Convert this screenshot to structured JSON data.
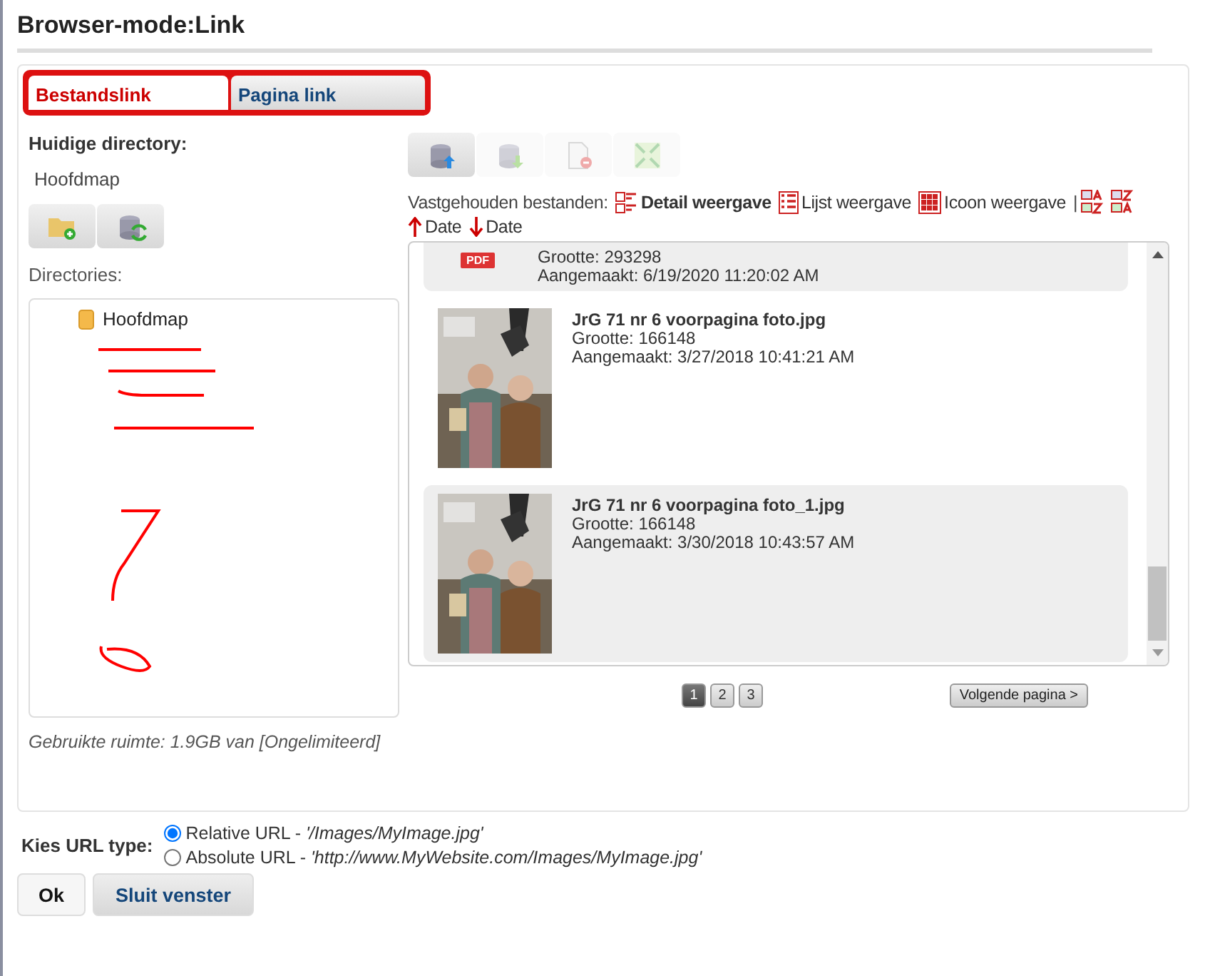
{
  "window": {
    "title": "Browser-mode:Link"
  },
  "tabs": [
    {
      "label": "Bestandslink",
      "selected": true
    },
    {
      "label": "Pagina link",
      "selected": false
    }
  ],
  "current_directory": {
    "label": "Huidige directory:",
    "value": "Hoofdmap"
  },
  "directory_toolbar": [
    {
      "kind": "new-folder",
      "disabled": false
    },
    {
      "kind": "refresh",
      "disabled": false
    }
  ],
  "file_toolbar": [
    {
      "kind": "upload",
      "disabled": false
    },
    {
      "kind": "download",
      "disabled": true
    },
    {
      "kind": "delete",
      "disabled": true
    },
    {
      "kind": "resize",
      "disabled": true
    }
  ],
  "directories": {
    "label": "Directories:",
    "tree": [
      {
        "name": "Hoofdmap"
      }
    ]
  },
  "usage": "Gebruikte ruimte: 1.9GB van [Ongelimiteerd]",
  "files_label": "Vastgehouden bestanden:",
  "views": [
    {
      "kind": "detail",
      "label": "Detail weergave",
      "selected": true
    },
    {
      "kind": "list",
      "label": "Lijst weergave",
      "selected": false
    },
    {
      "kind": "icon",
      "label": "Icoon weergave",
      "selected": false
    }
  ],
  "separator": "|",
  "sorts": [
    {
      "kind": "name-asc"
    },
    {
      "kind": "name-desc"
    },
    {
      "kind": "date-up",
      "label": "Date"
    },
    {
      "kind": "date-down",
      "label": "Date"
    }
  ],
  "files": [
    {
      "kind": "pdf",
      "badge": "PDF",
      "size": "Grootte: 293298",
      "created": "Aangemaakt: 6/19/2020 11:20:02 AM",
      "selected": true
    },
    {
      "kind": "picture",
      "name": "JrG 71 nr 6 voorpagina foto.jpg",
      "size": "Grootte: 166148",
      "created": "Aangemaakt: 3/27/2018 10:41:21 AM",
      "selected": false
    },
    {
      "kind": "picture",
      "name": "JrG 71 nr 6 voorpagina foto_1.jpg",
      "size": "Grootte: 166148",
      "created": "Aangemaakt: 3/30/2018 10:43:57 AM",
      "selected": true
    }
  ],
  "pages": [
    {
      "label": "1",
      "selected": true
    },
    {
      "label": "2",
      "selected": false
    },
    {
      "label": "3",
      "selected": false
    }
  ],
  "next_page": "Volgende pagina >",
  "url_type": {
    "label": "Kies URL type:",
    "options": [
      {
        "label": "Relative URL - ",
        "example": "'/Images/MyImage.jpg'",
        "selected": true
      },
      {
        "label": "Absolute URL - ",
        "example": "'http://www.MyWebsite.com/Images/MyImage.jpg'",
        "selected": false
      }
    ]
  },
  "buttons": [
    {
      "label": "Ok"
    },
    {
      "label": "Sluit venster"
    }
  ]
}
